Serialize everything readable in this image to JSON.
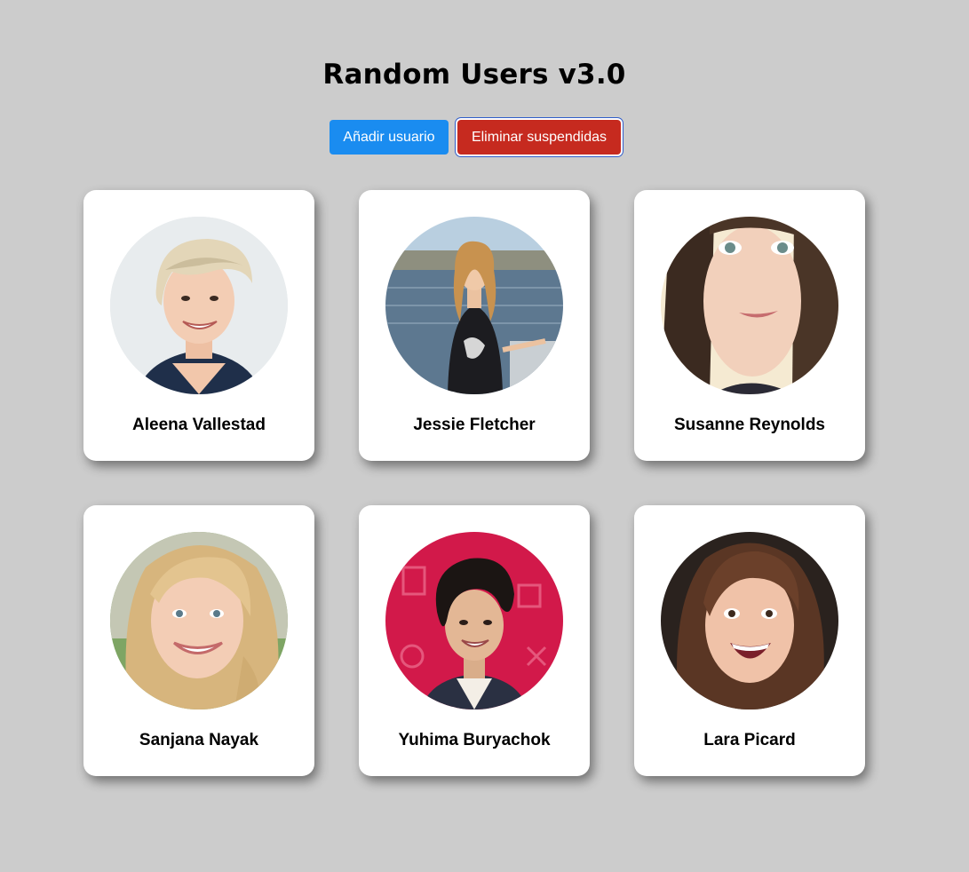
{
  "page": {
    "title": "Random Users v3.0"
  },
  "toolbar": {
    "add_label": "Añadir usuario",
    "remove_label": "Eliminar suspendidas"
  },
  "colors": {
    "background": "#cccccc",
    "add_button": "#1a8cf0",
    "remove_button": "#c62a1f",
    "card": "#ffffff"
  },
  "users": [
    {
      "name": "Aleena Vallestad",
      "photo": "avatar-photo"
    },
    {
      "name": "Jessie Fletcher",
      "photo": "avatar-photo"
    },
    {
      "name": "Susanne Reynolds",
      "photo": "avatar-photo"
    },
    {
      "name": "Sanjana Nayak",
      "photo": "avatar-photo"
    },
    {
      "name": "Yuhima Buryachok",
      "photo": "avatar-photo"
    },
    {
      "name": "Lara Picard",
      "photo": "avatar-photo"
    }
  ]
}
